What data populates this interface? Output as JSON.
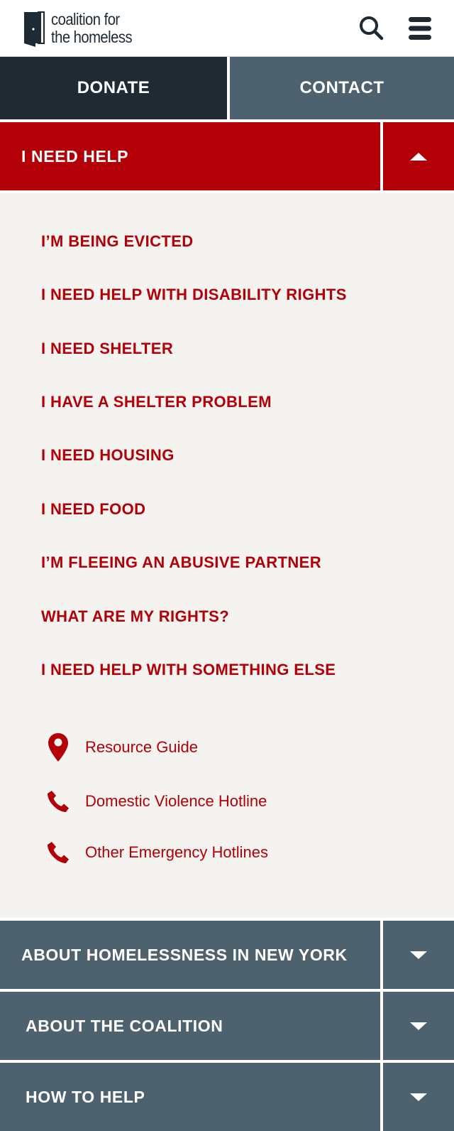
{
  "header": {
    "logo_line1": "coalition for",
    "logo_line2": "the homeless",
    "search_icon": "search-icon",
    "menu_icon": "hamburger-menu-icon"
  },
  "cta": {
    "donate": "DONATE",
    "contact": "CONTACT"
  },
  "help_section": {
    "label": "I NEED HELP",
    "expanded": true,
    "items": [
      "I’M BEING EVICTED",
      "I NEED HELP WITH DISABILITY RIGHTS",
      "I NEED SHELTER",
      "I HAVE A SHELTER PROBLEM",
      "I NEED HOUSING",
      "I NEED FOOD",
      "I’M FLEEING AN ABUSIVE PARTNER",
      "WHAT ARE MY RIGHTS?",
      "I NEED HELP WITH SOMETHING ELSE"
    ],
    "resources": [
      {
        "icon": "map-pin-icon",
        "label": "Resource Guide"
      },
      {
        "icon": "phone-icon",
        "label": "Domestic Violence Hotline"
      },
      {
        "icon": "phone-icon",
        "label": "Other Emergency Hotlines"
      }
    ]
  },
  "sections": [
    {
      "label": "ABOUT HOMELESSNESS IN NEW YORK",
      "expanded": false
    },
    {
      "label": "ABOUT THE COALITION",
      "expanded": false
    },
    {
      "label": "HOW TO HELP",
      "expanded": false
    }
  ],
  "colors": {
    "brand_red": "#b30008",
    "dark_navy": "#1f2a33",
    "slate": "#4e616e",
    "panel_bg": "#f5f3ef"
  }
}
